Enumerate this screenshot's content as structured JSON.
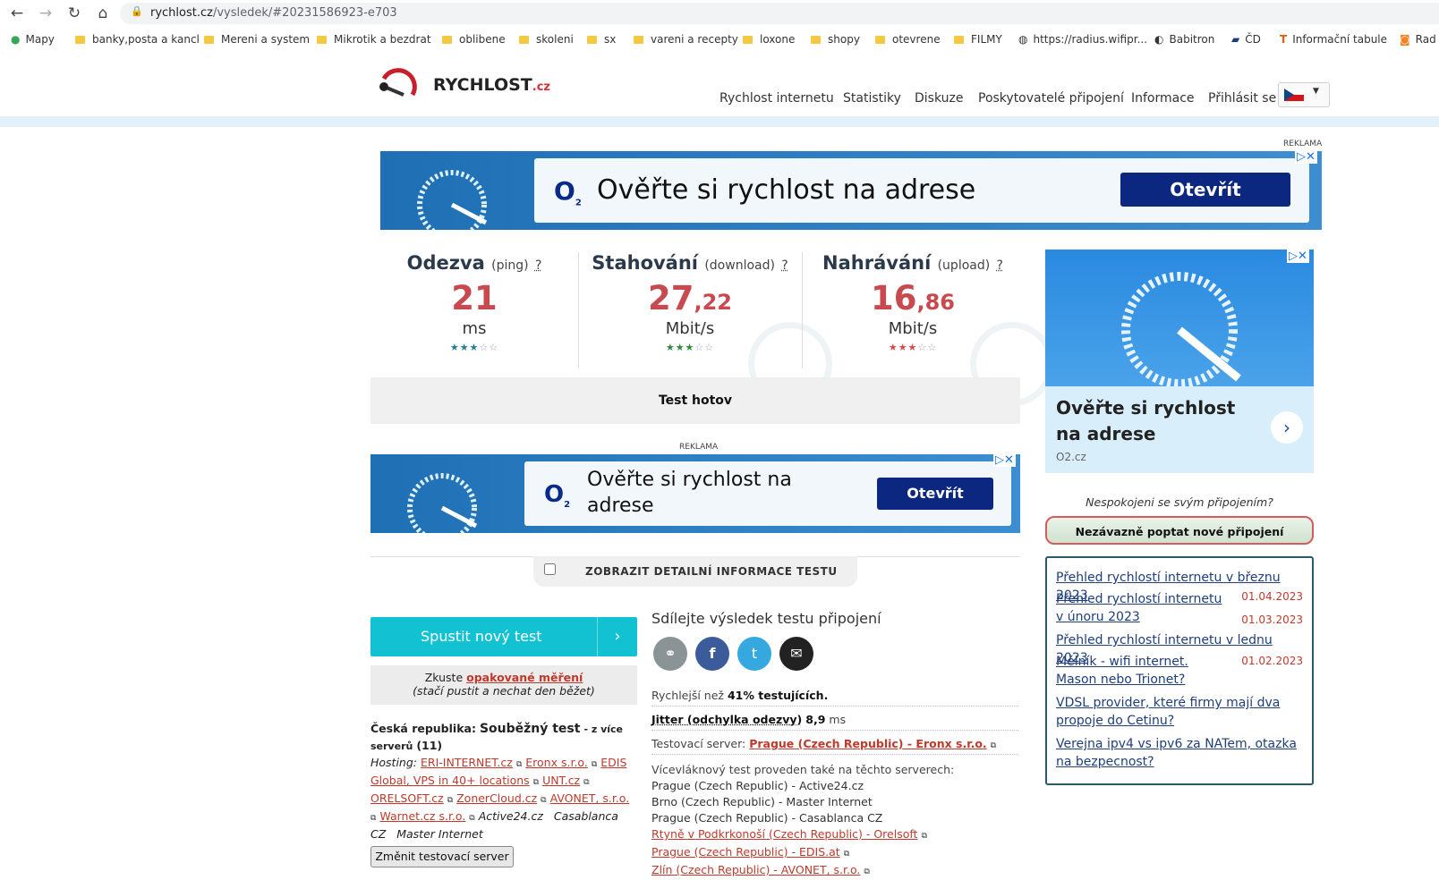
{
  "browser": {
    "url_host": "rychlost.cz",
    "url_path": "/vysledek/#20231586923-e703",
    "bookmarks": [
      "Mapy",
      "banky,posta a kancl",
      "Mereni a system",
      "Mikrotik a bezdrat",
      "oblibene",
      "skoleni",
      "sx",
      "vareni a recepty",
      "loxone",
      "shopy",
      "otevrene",
      "FILMY",
      "https://radius.wifipr...",
      "Babitron",
      "ČD",
      "Informační tabule",
      "Rad"
    ]
  },
  "site": {
    "logo_main": "RYCHLOST",
    "logo_tld": ".cz",
    "nav": [
      "Rychlost internetu",
      "Statistiky",
      "Diskuze",
      "Poskytovatelé připojení",
      "Informace",
      "Přihlásit se"
    ]
  },
  "ads": {
    "label": "REKLAMA",
    "brand": "O",
    "brand_sub": "2",
    "headline": "Ověřte si rychlost na adrese",
    "cta": "Otevřít",
    "domain": "O2.cz",
    "close": "▷✕"
  },
  "metrics": {
    "ping": {
      "title": "Odezva",
      "sub": "(ping)",
      "q": "?",
      "value": "21",
      "unit": "ms",
      "stars_on": "★★★",
      "stars_off": "☆☆"
    },
    "download": {
      "title": "Stahování",
      "sub": "(download)",
      "q": "?",
      "value_int": "27",
      "value_frac": ",22",
      "unit": "Mbit/s",
      "stars_on": "★★★",
      "stars_off": "☆☆"
    },
    "upload": {
      "title": "Nahrávání",
      "sub": "(upload)",
      "q": "?",
      "value_int": "16",
      "value_frac": ",86",
      "unit": "Mbit/s",
      "stars_on": "★★★",
      "stars_off": "☆☆"
    }
  },
  "status": "Test hotov",
  "details_toggle": "ZOBRAZIT DETAILNÍ INFORMACE TESTU",
  "left": {
    "run_button": "Spustit nový test",
    "try_prefix": "Zkuste",
    "try_link": "opakované měření",
    "try_note": "(stačí pustit a nechat den běžet)",
    "country": "Česká republika:",
    "concurrent": "Souběžný test",
    "multi": "- z více serverů",
    "count": "(11)",
    "hosting_label": "Hosting:",
    "hosts": [
      "ERI-INTERNET.cz",
      "Eronx s.r.o.",
      "EDIS Global, VPS in 40+ locations",
      "UNT.cz",
      "ORELSOFT.cz",
      "ZonerCloud.cz",
      "AVONET, s.r.o.",
      "Warnet.cz s.r.o."
    ],
    "hosts_plain": [
      "Active24.cz",
      "Casablanca CZ",
      "Master Internet"
    ],
    "change_server": "Změnit testovací server"
  },
  "share": {
    "title": "Sdílejte výsledek testu připojení",
    "faster_prefix": "Rychlejší než",
    "faster_value": "41% testujících.",
    "jitter_label": "Jitter (odchylka odezvy)",
    "jitter_value": "8,9",
    "jitter_unit": "ms",
    "server_label": "Testovací server:",
    "server_value": "Prague (Czech Republic) - Eronx s.r.o.",
    "multi_label": "Vícevláknový test proveden také na těchto serverech:",
    "servers": [
      "Prague (Czech Republic) - Active24.cz",
      "Brno (Czech Republic) - Master Internet",
      "Prague (Czech Republic) - Casablanca CZ"
    ],
    "server_links": [
      "Rtyně v Podkrkonoší (Czech Republic) - Orelsoft",
      "Prague (Czech Republic) - EDIS.at",
      "Zlín (Czech Republic) - AVONET, s.r.o."
    ]
  },
  "right": {
    "dissatisfied": "Nespokojeni se svým připojením?",
    "request_button": "Nezávazně poptat nové připojení",
    "news": [
      {
        "title": "Přehled rychlostí internetu v březnu 2023",
        "date": "01.04.2023"
      },
      {
        "title": "Přehled rychlostí internetu v únoru 2023",
        "date": "01.03.2023"
      },
      {
        "title": "Přehled rychlostí internetu v lednu 2023",
        "date": "01.02.2023"
      },
      {
        "title": "Mělník - wifi internet. Mason nebo Trionet?",
        "date": ""
      },
      {
        "title": "VDSL provider, které firmy mají dva propoje do Cetinu?",
        "date": ""
      },
      {
        "title": "Verejna ipv4 vs ipv6 za NATem, otazka na bezpecnost?",
        "date": ""
      }
    ]
  },
  "colors": {
    "accent": "#12c2d3",
    "value_red": "#c84a4f",
    "star_ping": "#1f7f8f",
    "star_down": "#2e8b3a",
    "star_up": "#d84a4a",
    "star_off": "#9aa"
  }
}
